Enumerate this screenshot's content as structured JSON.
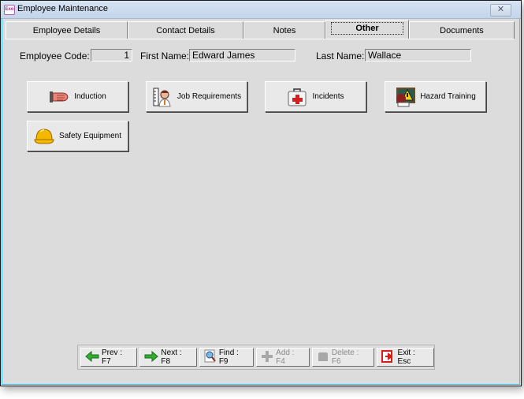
{
  "window": {
    "title": "Employee Maintenance",
    "app_icon_text": "Exo",
    "close_glyph": "✕"
  },
  "tabs": [
    {
      "label": "Employee Details",
      "active": false
    },
    {
      "label": "Contact Details",
      "active": false
    },
    {
      "label": "Notes",
      "active": false
    },
    {
      "label": "Other",
      "active": true
    },
    {
      "label": "Documents",
      "active": false
    }
  ],
  "header": {
    "employee_code_label": "Employee Code:",
    "employee_code_value": "1",
    "first_name_label": "First Name:",
    "first_name_value": "Edward James",
    "last_name_label": "Last Name:",
    "last_name_value": "Wallace"
  },
  "actions": [
    {
      "label": "Induction",
      "icon": "hand-icon"
    },
    {
      "label": "Job Requirements",
      "icon": "person-ruler-icon"
    },
    {
      "label": "Incidents",
      "icon": "first-aid-kit-icon"
    },
    {
      "label": "Hazard Training",
      "icon": "hazard-warning-icon"
    },
    {
      "label": "Safety Equipment",
      "icon": "hard-hat-icon"
    }
  ],
  "navigation": [
    {
      "label": "Prev : F7",
      "icon": "arrow-left-icon",
      "enabled": true
    },
    {
      "label": "Next : F8",
      "icon": "arrow-right-icon",
      "enabled": true
    },
    {
      "label": "Find : F9",
      "icon": "magnifier-icon",
      "enabled": true
    },
    {
      "label": "Add : F4",
      "icon": "plus-icon",
      "enabled": false
    },
    {
      "label": "Delete : F6",
      "icon": "delete-icon",
      "enabled": false
    },
    {
      "label": "Exit : Esc",
      "icon": "exit-icon",
      "enabled": true
    }
  ]
}
